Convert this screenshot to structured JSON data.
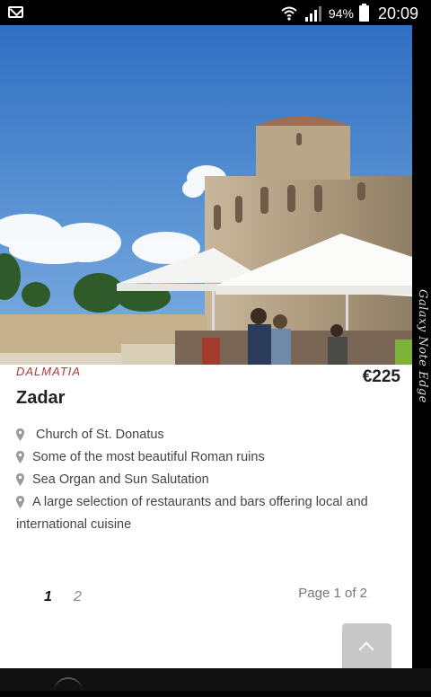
{
  "status_bar": {
    "battery_percent": "94%",
    "time": "20:09",
    "icons": [
      "mail-icon",
      "wifi-icon",
      "signal-icon",
      "battery-icon"
    ]
  },
  "device": {
    "edge_label": "Galaxy Note Edge"
  },
  "listing": {
    "category": "DALMATIA",
    "title": "Zadar",
    "price": "€225",
    "features": [
      "Church of St. Donatus",
      "Some of the most beautiful Roman ruins",
      "Sea Organ and Sun Salutation",
      "A large selection of restaurants and bars offering local and international cuisine"
    ],
    "accent_color": "#b13a33"
  },
  "pagination": {
    "pages": [
      "1",
      "2"
    ],
    "current_page": 1,
    "label": "Page 1 of 2"
  },
  "scroll_top": {
    "icon": "chevron-up-icon"
  }
}
